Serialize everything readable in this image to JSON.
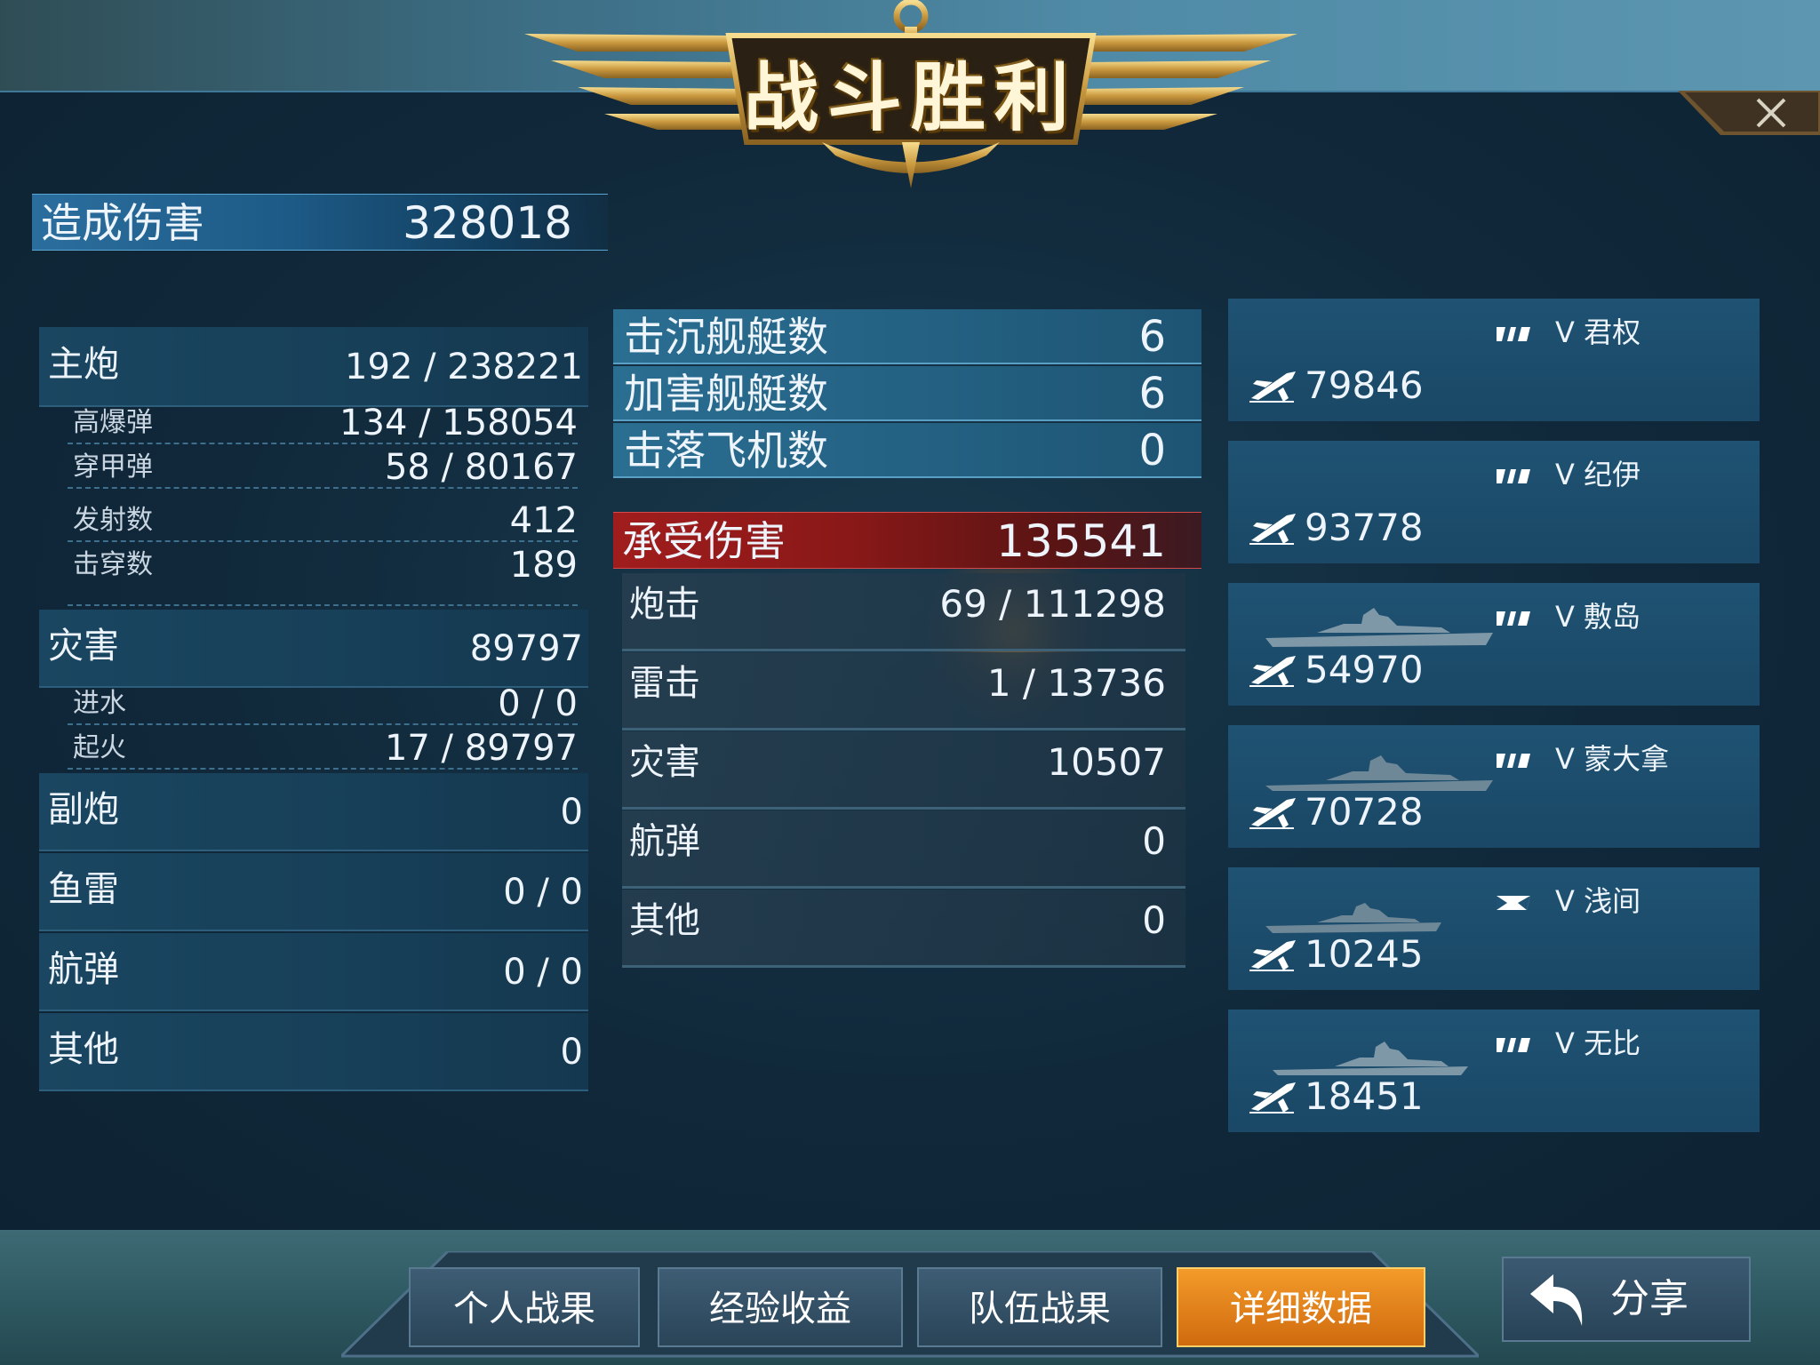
{
  "title": "战斗胜利",
  "damage_dealt": {
    "label": "造成伤害",
    "value": "328018"
  },
  "left_stats": {
    "main_gun": {
      "label": "主炮",
      "value": "192 / 238221"
    },
    "he": {
      "label": "高爆弹",
      "value": "134 / 158054"
    },
    "ap": {
      "label": "穿甲弹",
      "value": "58 / 80167"
    },
    "shots": {
      "label": "发射数",
      "value": "412"
    },
    "pens": {
      "label": "击穿数",
      "value": "189"
    },
    "disaster": {
      "label": "灾害",
      "value": "89797"
    },
    "flooding": {
      "label": "进水",
      "value": "0 / 0"
    },
    "fire": {
      "label": "起火",
      "value": "17 / 89797"
    },
    "secondary": {
      "label": "副炮",
      "value": "0"
    },
    "torpedo": {
      "label": "鱼雷",
      "value": "0 / 0"
    },
    "bombs": {
      "label": "航弹",
      "value": "0 / 0"
    },
    "other": {
      "label": "其他",
      "value": "0"
    }
  },
  "kill_stats": [
    {
      "label": "击沉舰艇数",
      "value": "6"
    },
    {
      "label": "加害舰艇数",
      "value": "6"
    },
    {
      "label": "击落飞机数",
      "value": "0"
    }
  ],
  "damage_taken": {
    "label": "承受伤害",
    "value": "135541",
    "rows": [
      {
        "label": "炮击",
        "value": "69 / 111298"
      },
      {
        "label": "雷击",
        "value": "1 / 13736"
      },
      {
        "label": "灾害",
        "value": "10507"
      },
      {
        "label": "航弹",
        "value": "0"
      },
      {
        "label": "其他",
        "value": "0"
      }
    ]
  },
  "enemies": [
    {
      "name": "V 君权",
      "damage": "79846",
      "flag_icon": "striped-flag-icon"
    },
    {
      "name": "V 纪伊",
      "damage": "93778",
      "flag_icon": "striped-flag-icon"
    },
    {
      "name": "V 敷岛",
      "damage": "54970",
      "flag_icon": "striped-flag-icon"
    },
    {
      "name": "V 蒙大拿",
      "damage": "70728",
      "flag_icon": "striped-flag-icon"
    },
    {
      "name": "V 浅间",
      "damage": "10245",
      "flag_icon": "rising-sun-flag-icon"
    },
    {
      "name": "V 无比",
      "damage": "18451",
      "flag_icon": "striped-flag-icon"
    }
  ],
  "tabs": [
    {
      "label": "个人战果",
      "active": false
    },
    {
      "label": "经验收益",
      "active": false
    },
    {
      "label": "队伍战果",
      "active": false
    },
    {
      "label": "详细数据",
      "active": true
    }
  ],
  "share_label": "分享",
  "colors": {
    "accent_orange": "#f39b2a",
    "panel_blue": "#1f5273",
    "damage_red": "#a11d1d",
    "gold": "#d9b25a"
  }
}
